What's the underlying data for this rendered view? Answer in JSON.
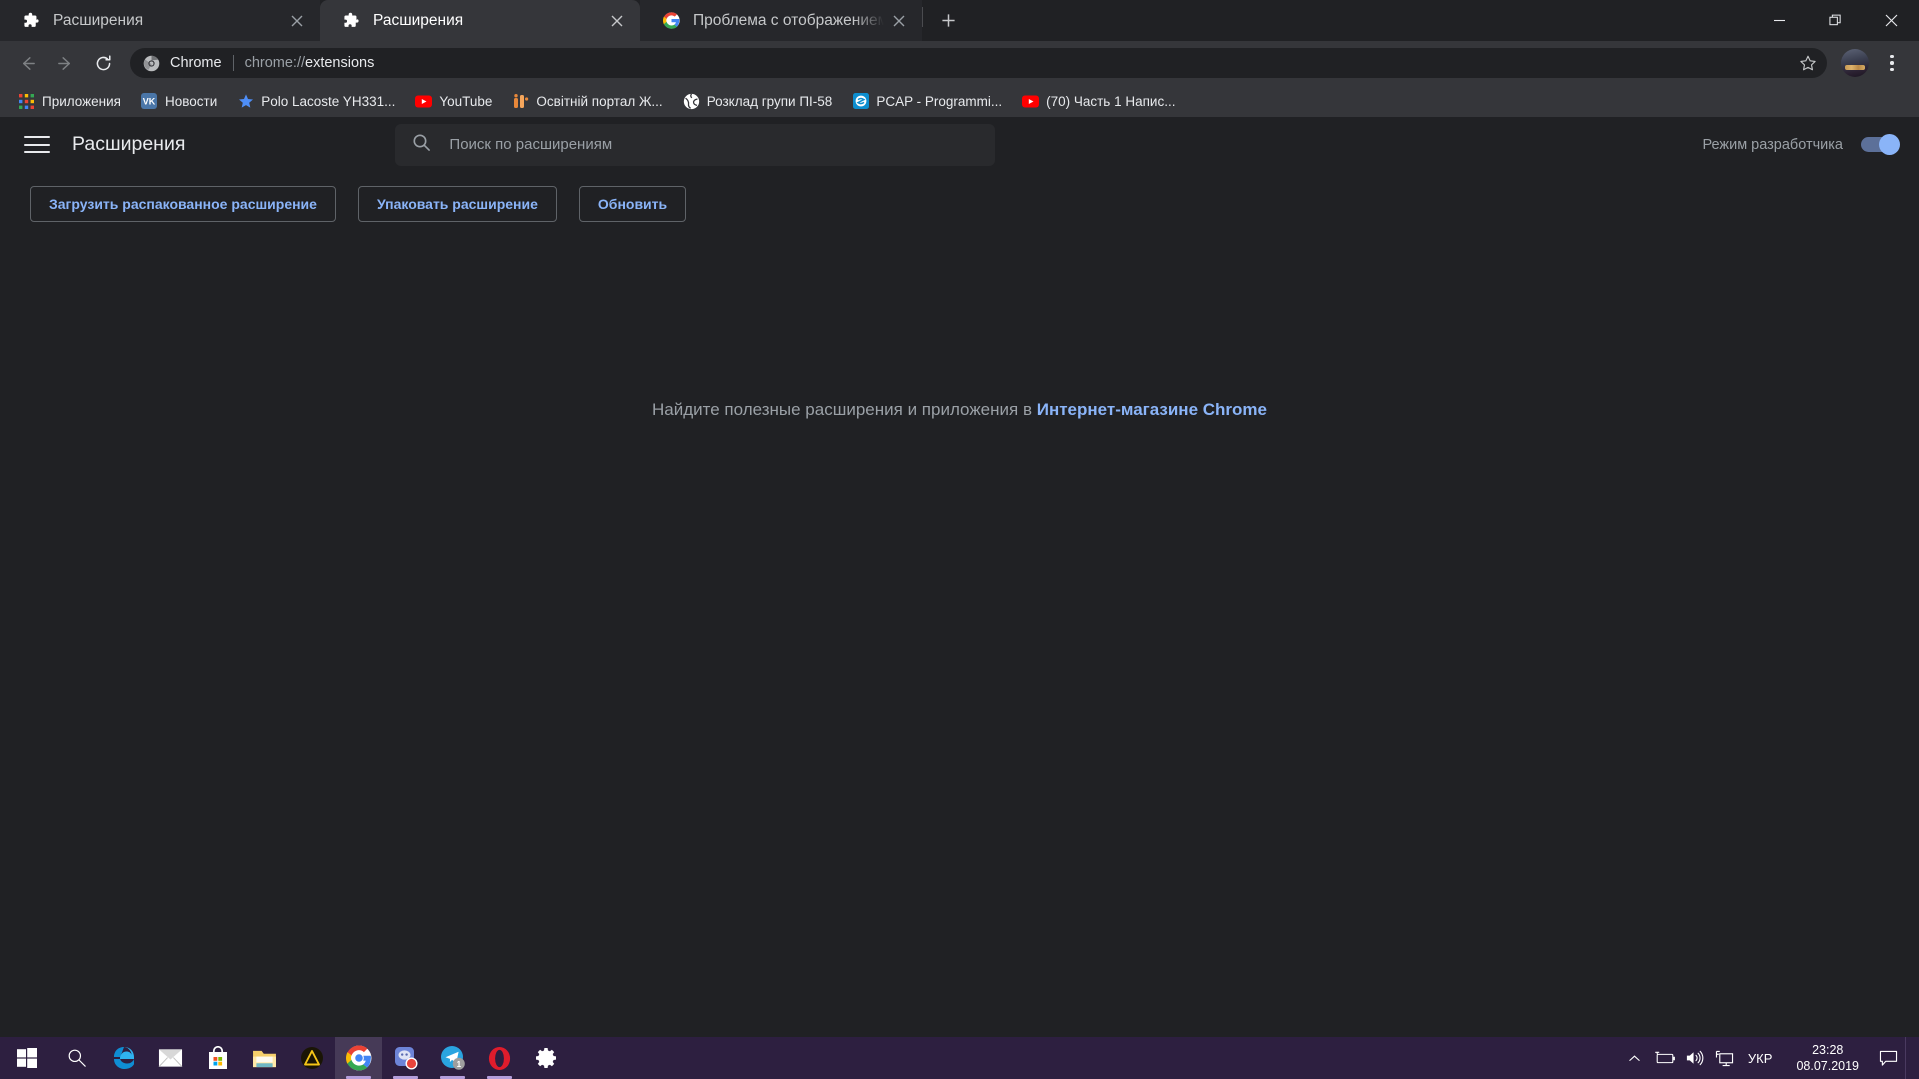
{
  "window": {
    "controls": {
      "minimize": "minimize-button",
      "restore": "restore-button",
      "close": "close-button"
    }
  },
  "tabs": [
    {
      "title": "Расширения",
      "favicon": "puzzle-icon",
      "active": false
    },
    {
      "title": "Расширения",
      "favicon": "puzzle-icon",
      "active": true
    },
    {
      "title": "Проблема с отображением инт",
      "favicon": "google-icon",
      "active": false
    }
  ],
  "newtab_label": "+",
  "toolbar": {
    "back": "back-arrow-icon",
    "forward": "forward-arrow-icon",
    "reload": "reload-icon",
    "omnibox": {
      "badge_icon": "chrome-icon",
      "badge_label": "Chrome",
      "url_scheme": "chrome://",
      "url_path": "extensions",
      "url_full": "chrome://extensions"
    },
    "star": "star-outline-icon",
    "avatar": "profile-avatar",
    "menu": "three-dot-menu-icon"
  },
  "bookmarks": [
    {
      "label": "Приложения",
      "icon": "apps-grid-icon",
      "color": "#4285f4"
    },
    {
      "label": "Новости",
      "icon": "vk-icon",
      "color": "#4a76a8"
    },
    {
      "label": "Polo Lacoste YH331...",
      "icon": "star-icon",
      "color": "#4e8ef7"
    },
    {
      "label": "YouTube",
      "icon": "youtube-icon",
      "color": "#ff0000"
    },
    {
      "label": "Освітній портал Ж...",
      "icon": "generic-orange-icon",
      "color": "#e8883a"
    },
    {
      "label": "Розклад групи ПІ-58",
      "icon": "globe-icon",
      "color": "#ffffff"
    },
    {
      "label": "PCAP - Programmi...",
      "icon": "pcap-icon",
      "color": "#0d8ecf"
    },
    {
      "label": "(70) Часть 1 Напис...",
      "icon": "youtube-icon",
      "color": "#ff0000"
    }
  ],
  "extensions_page": {
    "menu_icon": "hamburger-menu-icon",
    "title": "Расширения",
    "search": {
      "icon": "search-icon",
      "placeholder": "Поиск по расширениям",
      "value": ""
    },
    "developer_mode": {
      "label": "Режим разработчика",
      "enabled": true,
      "accent_color": "#8ab4f8"
    },
    "buttons": [
      {
        "label": "Загрузить распакованное расширение"
      },
      {
        "label": "Упаковать расширение"
      },
      {
        "label": "Обновить"
      }
    ],
    "empty_state": {
      "text_before": "Найдите полезные расширения и приложения в ",
      "link_text": "Интернет-магазине Chrome"
    }
  },
  "taskbar": {
    "items": [
      {
        "name": "start-button",
        "icon": "windows-logo-icon"
      },
      {
        "name": "search-button",
        "icon": "search-icon"
      },
      {
        "name": "edge-button",
        "icon": "edge-icon"
      },
      {
        "name": "mail-button",
        "icon": "mail-icon"
      },
      {
        "name": "store-button",
        "icon": "microsoft-store-icon"
      },
      {
        "name": "file-explorer-button",
        "icon": "folder-icon"
      },
      {
        "name": "adobe-button",
        "icon": "triangle-warning-icon"
      },
      {
        "name": "chrome-button",
        "icon": "chrome-icon"
      },
      {
        "name": "app-button",
        "icon": "blue-app-icon"
      },
      {
        "name": "telegram-button",
        "icon": "telegram-icon",
        "badge": "1"
      },
      {
        "name": "opera-button",
        "icon": "opera-icon"
      },
      {
        "name": "settings-button",
        "icon": "gear-icon"
      }
    ],
    "tray": {
      "overflow": "chevron-up-icon",
      "battery": "battery-charging-icon",
      "volume": "volume-icon",
      "network": "network-display-icon",
      "language": "УКР",
      "time": "23:28",
      "date": "08.07.2019",
      "notifications": "notification-icon"
    }
  },
  "colors": {
    "tabstrip_bg": "#202124",
    "toolbar_bg": "#35363a",
    "page_bg": "#202124",
    "accent_blue": "#8ab4f8",
    "taskbar_bg": "#2d1f40"
  }
}
